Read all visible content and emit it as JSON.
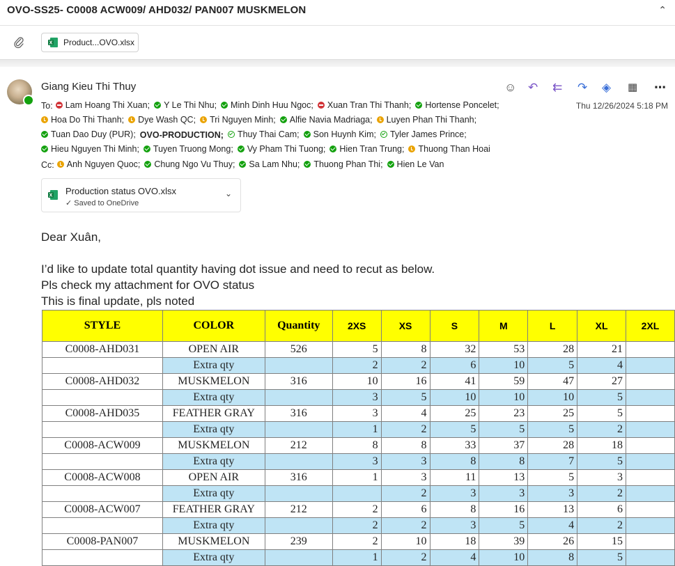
{
  "subject": "OVO-SS25- C0008 ACW009/ AHD032/ PAN007 MUSKMELON",
  "attachment_chip": "Product...OVO.xlsx",
  "sender": "Giang Kieu Thi Thuy",
  "date": "Thu 12/26/2024 5:18 PM",
  "to_label": "To:",
  "cc_label": "Cc:",
  "recipient_lines": [
    {
      "label": "To:",
      "people": [
        {
          "name": "Lam Hoang Thi Xuan;",
          "status": "red"
        },
        {
          "name": "Y Le Thi Nhu;",
          "status": "green"
        },
        {
          "name": "Minh Dinh Huu Ngoc;",
          "status": "green"
        },
        {
          "name": "Xuan Tran Thi Thanh;",
          "status": "red"
        },
        {
          "name": "Hortense Poncelet;",
          "status": "green"
        }
      ]
    },
    {
      "label": "",
      "people": [
        {
          "name": "Hoa Do Thi Thanh;",
          "status": "yellow"
        },
        {
          "name": "Dye Wash QC;",
          "status": "yellow"
        },
        {
          "name": "Tri Nguyen Minh;",
          "status": "yellow"
        },
        {
          "name": "Alfie Navia Madriaga;",
          "status": "green"
        },
        {
          "name": "Luyen Phan Thi Thanh;",
          "status": "yellow"
        }
      ]
    },
    {
      "label": "",
      "people": [
        {
          "name": "Tuan Dao Duy (PUR);",
          "status": "green"
        },
        {
          "name": "OVO-PRODUCTION;",
          "status": "none",
          "bold": true
        },
        {
          "name": "Thuy Thai Cam;",
          "status": "outline"
        },
        {
          "name": "Son Huynh Kim;",
          "status": "green"
        },
        {
          "name": "Tyler James Prince;",
          "status": "outline"
        }
      ]
    },
    {
      "label": "",
      "people": [
        {
          "name": "Hieu Nguyen Thi Minh;",
          "status": "green"
        },
        {
          "name": "Tuyen Truong Mong;",
          "status": "green"
        },
        {
          "name": "Vy Pham Thi Tuong;",
          "status": "green"
        },
        {
          "name": "Hien Tran Trung;",
          "status": "green"
        },
        {
          "name": "Thuong Than Hoai",
          "status": "yellow"
        }
      ]
    },
    {
      "label": "Cc:",
      "people": [
        {
          "name": "Anh Nguyen Quoc;",
          "status": "yellow"
        },
        {
          "name": "Chung Ngo Vu Thuy;",
          "status": "green"
        },
        {
          "name": "Sa Lam Nhu;",
          "status": "green"
        },
        {
          "name": "Thuong Phan Thi;",
          "status": "green"
        },
        {
          "name": "Hien Le Van",
          "status": "green"
        }
      ]
    }
  ],
  "file_card": {
    "name": "Production status OVO.xlsx",
    "sub": "Saved to OneDrive"
  },
  "body": {
    "greeting": "Dear Xuân,",
    "line1": "I’d like to update total quantity having dot issue and need to recut as below.",
    "line2": "Pls check my attachment for OVO status",
    "line3": "This is final update, pls noted"
  },
  "table": {
    "headers": [
      "STYLE",
      "COLOR",
      "Quantity",
      "2XS",
      "XS",
      "S",
      "M",
      "L",
      "XL",
      "2XL"
    ],
    "rows": [
      {
        "extra": false,
        "cells": [
          "C0008-AHD031",
          "OPEN AIR",
          "526",
          "5",
          "8",
          "32",
          "53",
          "28",
          "21",
          ""
        ]
      },
      {
        "extra": true,
        "cells": [
          "",
          "Extra qty",
          "",
          "2",
          "2",
          "6",
          "10",
          "5",
          "4",
          ""
        ]
      },
      {
        "extra": false,
        "cells": [
          "C0008-AHD032",
          "MUSKMELON",
          "316",
          "10",
          "16",
          "41",
          "59",
          "47",
          "27",
          ""
        ]
      },
      {
        "extra": true,
        "cells": [
          "",
          "Extra qty",
          "",
          "3",
          "5",
          "10",
          "10",
          "10",
          "5",
          ""
        ]
      },
      {
        "extra": false,
        "cells": [
          "C0008-AHD035",
          "FEATHER GRAY",
          "316",
          "3",
          "4",
          "25",
          "23",
          "25",
          "5",
          ""
        ]
      },
      {
        "extra": true,
        "cells": [
          "",
          "Extra qty",
          "",
          "1",
          "2",
          "5",
          "5",
          "5",
          "2",
          ""
        ]
      },
      {
        "extra": false,
        "cells": [
          "C0008-ACW009",
          "MUSKMELON",
          "212",
          "8",
          "8",
          "33",
          "37",
          "28",
          "18",
          ""
        ]
      },
      {
        "extra": true,
        "cells": [
          "",
          "Extra qty",
          "",
          "3",
          "3",
          "8",
          "8",
          "7",
          "5",
          ""
        ]
      },
      {
        "extra": false,
        "cells": [
          "C0008-ACW008",
          "OPEN AIR",
          "316",
          "1",
          "3",
          "11",
          "13",
          "5",
          "3",
          ""
        ]
      },
      {
        "extra": true,
        "cells": [
          "",
          "Extra qty",
          "",
          "",
          "2",
          "3",
          "3",
          "3",
          "2",
          ""
        ]
      },
      {
        "extra": false,
        "cells": [
          "C0008-ACW007",
          "FEATHER GRAY",
          "212",
          "2",
          "6",
          "8",
          "16",
          "13",
          "6",
          ""
        ]
      },
      {
        "extra": true,
        "cells": [
          "",
          "Extra qty",
          "",
          "2",
          "2",
          "3",
          "5",
          "4",
          "2",
          ""
        ]
      },
      {
        "extra": false,
        "cells": [
          "C0008-PAN007",
          "MUSKMELON",
          "239",
          "2",
          "10",
          "18",
          "39",
          "26",
          "15",
          ""
        ]
      },
      {
        "extra": true,
        "cells": [
          "",
          "Extra qty",
          "",
          "1",
          "2",
          "4",
          "10",
          "8",
          "5",
          ""
        ]
      }
    ]
  }
}
